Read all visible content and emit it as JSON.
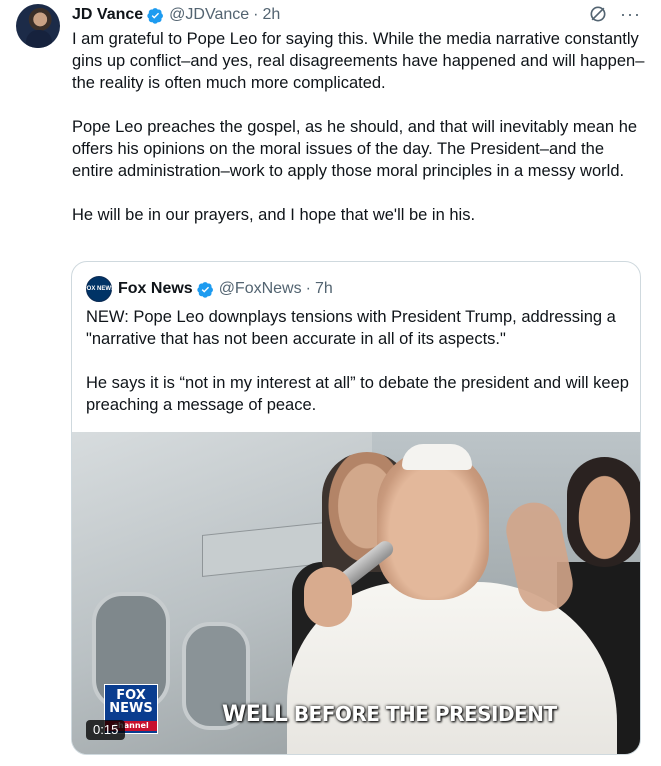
{
  "tweet": {
    "author_name": "JD Vance",
    "author_handle": "@JDVance",
    "time": "2h",
    "separator": "·",
    "paragraphs": [
      "I am grateful to Pope Leo for saying this. While the media narrative constantly gins up conflict–and yes, real disagreements have happened and will happen–the reality is often much more complicated.",
      "Pope Leo preaches the gospel, as he should, and that will inevitably mean he offers his opinions on the moral issues of the day. The President–and the entire administration–work to apply those moral principles in a messy world.",
      "He will be in our prayers, and I hope that we'll be in his."
    ],
    "more_glyph": "···",
    "grok_icon": "grok-icon",
    "verified_color": "#1d9bf0"
  },
  "quote": {
    "author_name": "Fox News",
    "author_handle": "@FoxNews",
    "time": "7h",
    "separator": "·",
    "logo_text": "FOX NEWS",
    "paragraphs": [
      "NEW: Pope Leo downplays tensions with President Trump, addressing a \"narrative that has not been accurate in all of its aspects.\"",
      "He says it is “not in my interest at all” to debate the president and will keep preaching a message of peace."
    ],
    "media": {
      "duration": "0:15",
      "chyron_word1": "WELL",
      "chyron_rest": "BEFORE THE PRESIDENT",
      "bug_top": "FOX",
      "bug_mid": "NEWS",
      "bug_bottom": "channel"
    }
  }
}
